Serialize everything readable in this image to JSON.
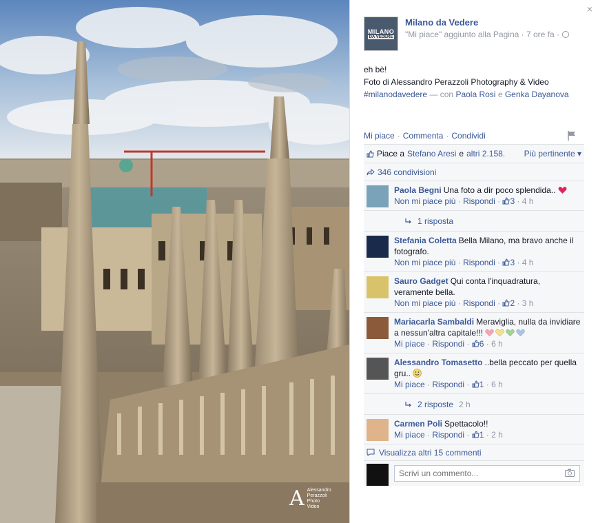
{
  "photo": {
    "watermark": [
      "Alessandro",
      "Perazzoli",
      "Photo",
      "Video"
    ]
  },
  "panel": {
    "close_label": "×",
    "page": {
      "avatar_top": "MILANO",
      "avatar_bottom": "DA VEDERE",
      "name": "Milano da Vedere",
      "meta": "\"Mi piace\" aggiunto alla Pagina · 7 ore fa ·"
    },
    "post": {
      "line1": "eh bè!",
      "line2": "Foto di Alessandro Perazzoli Photography & Video",
      "hashtag": "#milanodavedere",
      "with_text": "— con",
      "tag1": "Paola Rosi",
      "and_text": "e",
      "tag2": "Genka Dayanova"
    },
    "actions": {
      "like": "Mi piace",
      "comment": "Commenta",
      "share": "Condividi",
      "sep": "·"
    },
    "likes": {
      "prefix": "Piace a",
      "person": "Stefano Aresi",
      "and": "e",
      "others": "altri 2.158.",
      "sort": "Più pertinente ▾"
    },
    "shares": {
      "label": "346 condivisioni"
    },
    "comments": [
      {
        "author": "Paola Begni",
        "text": "Una foto a dir poco splendida..",
        "like_label": "Non mi piace più",
        "reply_label": "Rispondi",
        "likes": "3",
        "time": "4 h",
        "avatar_color": "#7aa2b8",
        "has_heart": true,
        "replies": "1 risposta",
        "replies_time": ""
      },
      {
        "author": "Stefania Coletta",
        "text": "Bella Milano, ma bravo anche il fotografo.",
        "like_label": "Non mi piace più",
        "reply_label": "Rispondi",
        "likes": "3",
        "time": "4 h",
        "avatar_color": "#1a2a4a"
      },
      {
        "author": "Sauro Gadget",
        "text": "Qui conta l'inquadratura, veramente bella.",
        "like_label": "Non mi piace più",
        "reply_label": "Rispondi",
        "likes": "2",
        "time": "3 h",
        "avatar_color": "#d9c36a"
      },
      {
        "author": "Mariacarla Sambaldi",
        "text": "Meraviglia, nulla da invidiare a nessun'altra capitale!!!",
        "like_label": "Mi piace",
        "reply_label": "Rispondi",
        "likes": "6",
        "time": "6 h",
        "avatar_color": "#8a5a3a",
        "hearts": [
          "#f4a6b5",
          "#f7e08a",
          "#9ed68c",
          "#a8c4ee"
        ]
      },
      {
        "author": "Alessandro Tomasetto",
        "text": "..bella peccato per quella gru..",
        "like_label": "Mi piace",
        "reply_label": "Rispondi",
        "likes": "1",
        "time": "6 h",
        "avatar_color": "#555555",
        "has_smile": true,
        "replies": "2 risposte",
        "replies_time": "2 h"
      },
      {
        "author": "Carmen Poli",
        "text": "Spettacolo!!",
        "like_label": "Mi piace",
        "reply_label": "Rispondi",
        "likes": "1",
        "time": "2 h",
        "avatar_color": "#e0b48a"
      }
    ],
    "more_comments": "Visualizza altri 15 commenti",
    "write_placeholder": "Scrivi un commento...",
    "colors": {
      "link": "#3b5998",
      "meta": "#9197a3",
      "feedback_bg": "#f6f7f9"
    }
  }
}
